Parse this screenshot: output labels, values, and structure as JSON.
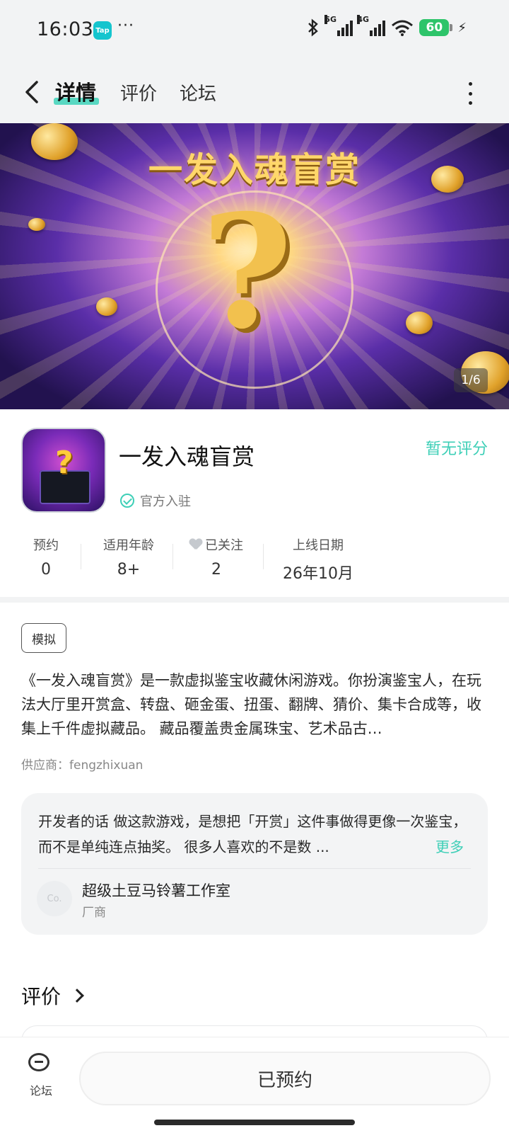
{
  "status_bar": {
    "time": "16:03",
    "app_badge": "Tap",
    "dots": "···",
    "signal1": "5G",
    "signal2": "4G",
    "battery": "60"
  },
  "nav": {
    "tabs": [
      "详情",
      "评价",
      "论坛"
    ],
    "active_tab": "详情"
  },
  "hero": {
    "title": "一发入魂盲赏",
    "counter": "1/6"
  },
  "app": {
    "name": "一发入魂盲赏",
    "rating": "暂无评分",
    "official": "官方入驻",
    "stats": [
      {
        "label": "预约",
        "value": "0"
      },
      {
        "label": "适用年龄",
        "value": "8+"
      },
      {
        "label": "已关注",
        "value": "2"
      },
      {
        "label": "上线日期",
        "value": "26年10月"
      }
    ]
  },
  "tag": "模拟",
  "description": "《一发入魂盲赏》是一款虚拟鉴宝收藏休闲游戏。你扮演鉴宝人，在玩法大厅里开赏盒、转盘、砸金蛋、扭蛋、翻牌、猜价、集卡合成等，收集上千件虚拟藏品。 藏品覆盖贵金属珠宝、艺术品古…",
  "supplier": "供应商：fengzhixuan",
  "developer": {
    "text": "开发者的话  做这款游戏，是想把「开赏」这件事做得更像一次鉴宝，而不是单纯连点抽奖。 很多人喜欢的不是数 ...",
    "more": "更多",
    "avatar": "Co.",
    "studio": "超级土豆马铃薯工作室",
    "role": "厂商"
  },
  "reviews": {
    "title": "评价"
  },
  "bottom": {
    "forum": "论坛",
    "reserved": "已预约"
  },
  "colors": {
    "accent": "#3ecfb7",
    "background": "#f2f3f4"
  }
}
